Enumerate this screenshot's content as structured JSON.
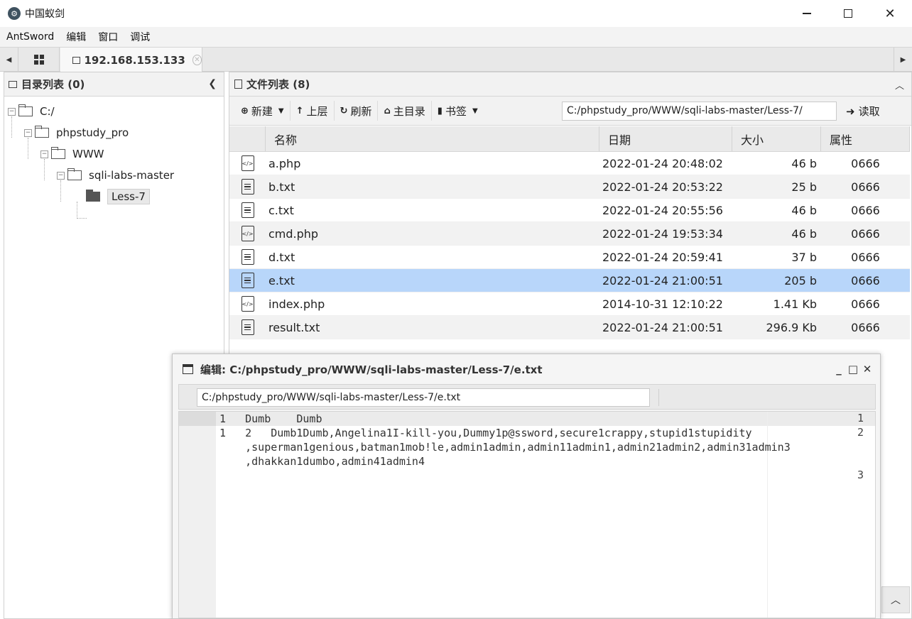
{
  "window": {
    "title": "中国蚁剑",
    "logo_glyph": "⚙"
  },
  "menu": [
    "AntSword",
    "编辑",
    "窗口",
    "调试"
  ],
  "tabs": {
    "active_label": "192.168.153.133"
  },
  "left_panel": {
    "header": "目录列表 (0)",
    "tree": [
      "C:/",
      "phpstudy_pro",
      "WWW",
      "sqli-labs-master",
      "Less-7"
    ]
  },
  "right_panel": {
    "header": "文件列表 (8)",
    "toolbar": {
      "new_label": "新建",
      "up_label": "上层",
      "refresh_label": "刷新",
      "home_label": "主目录",
      "bookmark_label": "书签",
      "path_value": "C:/phpstudy_pro/WWW/sqli-labs-master/Less-7/",
      "read_label": "读取"
    },
    "columns": {
      "name": "名称",
      "date": "日期",
      "size": "大小",
      "attr": "属性"
    },
    "files": [
      {
        "name": "a.php",
        "date": "2022-01-24 20:48:02",
        "size": "46 b",
        "attr": "0666",
        "icon": "code-file-icon"
      },
      {
        "name": "b.txt",
        "date": "2022-01-24 20:53:22",
        "size": "25 b",
        "attr": "0666",
        "icon": "text-file-icon"
      },
      {
        "name": "c.txt",
        "date": "2022-01-24 20:55:56",
        "size": "46 b",
        "attr": "0666",
        "icon": "text-file-icon"
      },
      {
        "name": "cmd.php",
        "date": "2022-01-24 19:53:34",
        "size": "46 b",
        "attr": "0666",
        "icon": "code-file-icon"
      },
      {
        "name": "d.txt",
        "date": "2022-01-24 20:59:41",
        "size": "37 b",
        "attr": "0666",
        "icon": "text-file-icon"
      },
      {
        "name": "e.txt",
        "date": "2022-01-24 21:00:51",
        "size": "205 b",
        "attr": "0666",
        "icon": "text-file-icon"
      },
      {
        "name": "index.php",
        "date": "2014-10-31 12:10:22",
        "size": "1.41 Kb",
        "attr": "0666",
        "icon": "code-file-icon"
      },
      {
        "name": "result.txt",
        "date": "2022-01-24 21:00:51",
        "size": "296.9 Kb",
        "attr": "0666",
        "icon": "text-file-icon"
      }
    ],
    "selected_index": 5
  },
  "editor_dialog": {
    "title": "编辑: C:/phpstudy_pro/WWW/sqli-labs-master/Less-7/e.txt",
    "path_value": "C:/phpstudy_pro/WWW/sqli-labs-master/Less-7/e.txt",
    "line_numbers": [
      "1",
      "2",
      "3"
    ],
    "code_lines": [
      "1   Dumb    Dumb",
      "1   2   Dumb1Dumb,Angelina1I-kill-you,Dummy1p@ssword,secure1crappy,stupid1stupidity",
      "    ,superman1genious,batman1mob!le,admin1admin,admin11admin1,admin21admin2,admin31admin3",
      "    ,dhakkan1dumbo,admin41admin4"
    ]
  },
  "colors": {
    "selected_row": "#b8d6fa",
    "panel_header": "#f2f2f2"
  }
}
